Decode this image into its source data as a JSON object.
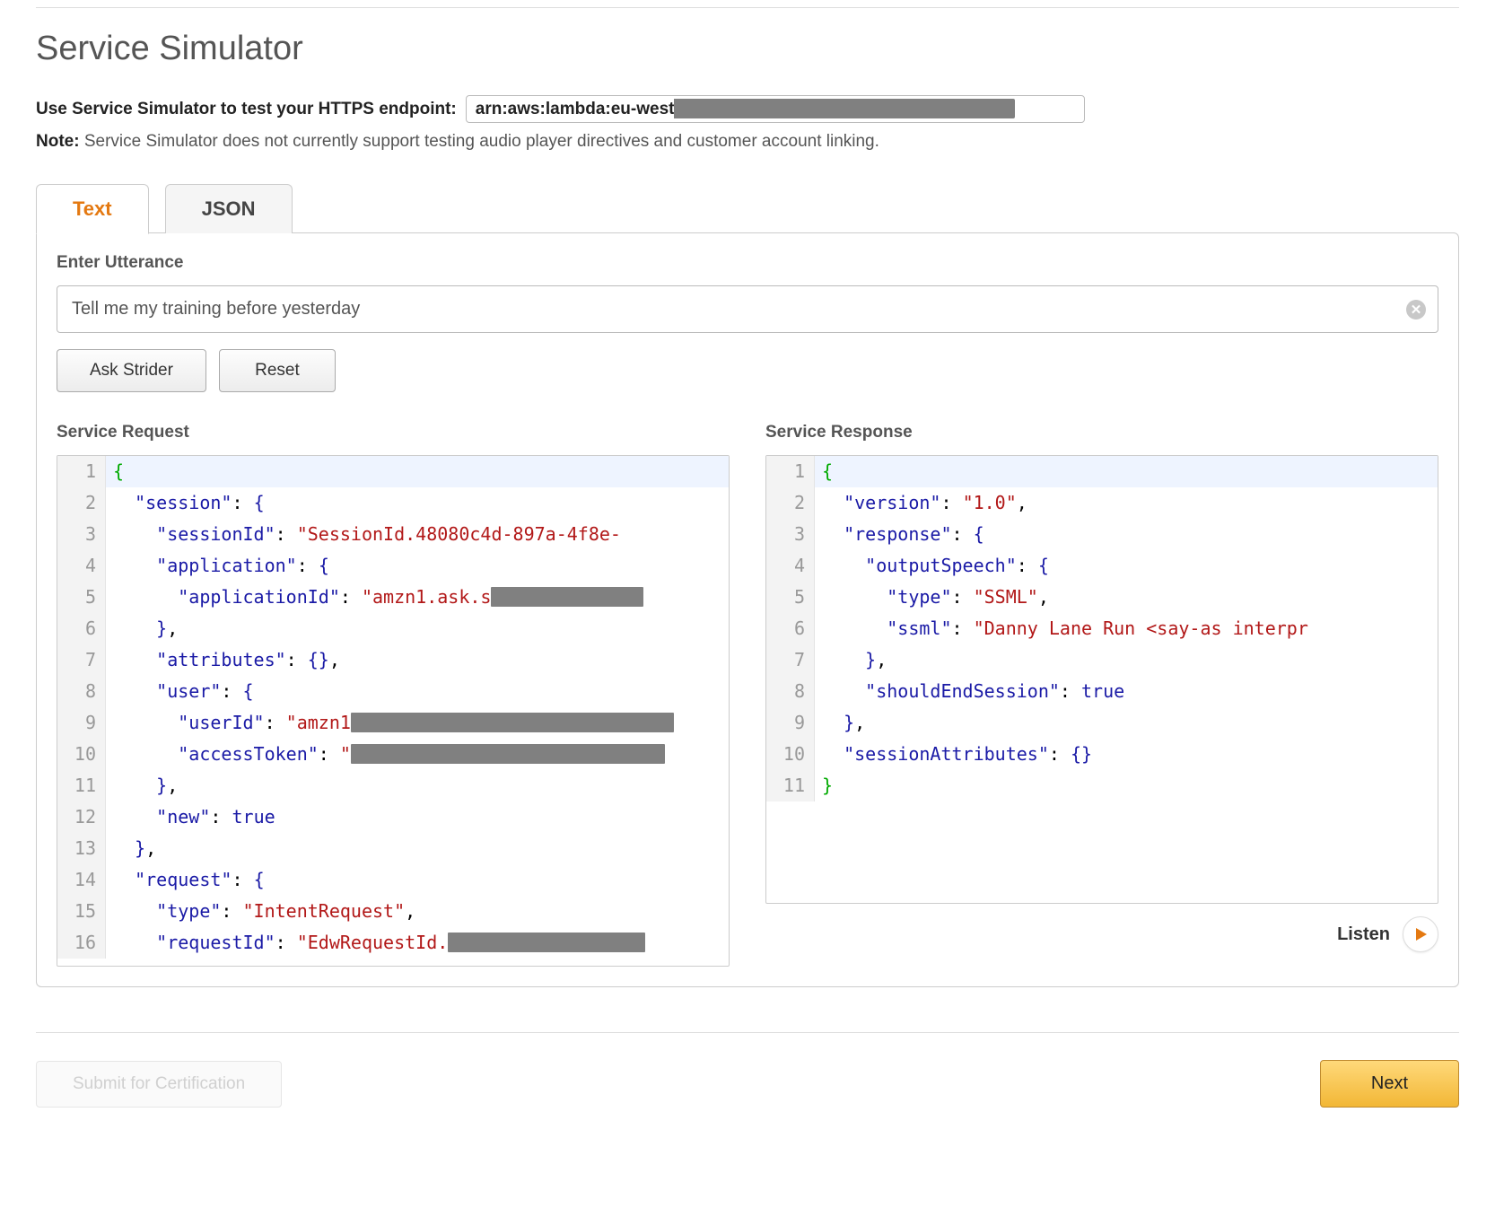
{
  "title": "Service Simulator",
  "intro_label": "Use Service Simulator to test your HTTPS endpoint:",
  "endpoint_prefix": "arn:aws:lambda:eu-west",
  "note_prefix": "Note:",
  "note_text": " Service Simulator does not currently support testing audio player directives and customer account linking.",
  "tabs": {
    "text": "Text",
    "json": "JSON"
  },
  "utterance": {
    "label": "Enter Utterance",
    "value": "Tell me my training before yesterday"
  },
  "buttons": {
    "ask": "Ask Strider",
    "reset": "Reset",
    "submit_cert": "Submit for Certification",
    "next": "Next",
    "listen": "Listen"
  },
  "request": {
    "label": "Service Request",
    "lines": [
      {
        "n": 1,
        "indent": 0,
        "tokens": [
          [
            "brace",
            "{"
          ]
        ]
      },
      {
        "n": 2,
        "indent": 1,
        "tokens": [
          [
            "key",
            "\"session\""
          ],
          [
            "punc",
            ": "
          ],
          [
            "brace-blue",
            "{"
          ]
        ]
      },
      {
        "n": 3,
        "indent": 2,
        "tokens": [
          [
            "key",
            "\"sessionId\""
          ],
          [
            "punc",
            ": "
          ],
          [
            "str",
            "\"SessionId.48080c4d-897a-4f8e-"
          ]
        ]
      },
      {
        "n": 4,
        "indent": 2,
        "tokens": [
          [
            "key",
            "\"application\""
          ],
          [
            "punc",
            ": "
          ],
          [
            "brace-blue",
            "{"
          ]
        ]
      },
      {
        "n": 5,
        "indent": 3,
        "tokens": [
          [
            "key",
            "\"applicationId\""
          ],
          [
            "punc",
            ": "
          ],
          [
            "str",
            "\"amzn1.ask.s"
          ],
          [
            "redact",
            170
          ]
        ]
      },
      {
        "n": 6,
        "indent": 2,
        "tokens": [
          [
            "brace-blue",
            "}"
          ],
          [
            "punc",
            ","
          ]
        ]
      },
      {
        "n": 7,
        "indent": 2,
        "tokens": [
          [
            "key",
            "\"attributes\""
          ],
          [
            "punc",
            ": "
          ],
          [
            "brace-blue",
            "{}"
          ],
          [
            "punc",
            ","
          ]
        ]
      },
      {
        "n": 8,
        "indent": 2,
        "tokens": [
          [
            "key",
            "\"user\""
          ],
          [
            "punc",
            ": "
          ],
          [
            "brace-blue",
            "{"
          ]
        ]
      },
      {
        "n": 9,
        "indent": 3,
        "tokens": [
          [
            "key",
            "\"userId\""
          ],
          [
            "punc",
            ": "
          ],
          [
            "str",
            "\"amzn1"
          ],
          [
            "redact",
            360
          ]
        ]
      },
      {
        "n": 10,
        "indent": 3,
        "tokens": [
          [
            "key",
            "\"accessToken\""
          ],
          [
            "punc",
            ": "
          ],
          [
            "str",
            "\""
          ],
          [
            "redact",
            350
          ]
        ]
      },
      {
        "n": 11,
        "indent": 2,
        "tokens": [
          [
            "brace-blue",
            "}"
          ],
          [
            "punc",
            ","
          ]
        ]
      },
      {
        "n": 12,
        "indent": 2,
        "tokens": [
          [
            "key",
            "\"new\""
          ],
          [
            "punc",
            ": "
          ],
          [
            "bool",
            "true"
          ]
        ]
      },
      {
        "n": 13,
        "indent": 1,
        "tokens": [
          [
            "brace-blue",
            "}"
          ],
          [
            "punc",
            ","
          ]
        ]
      },
      {
        "n": 14,
        "indent": 1,
        "tokens": [
          [
            "key",
            "\"request\""
          ],
          [
            "punc",
            ": "
          ],
          [
            "brace-blue",
            "{"
          ]
        ]
      },
      {
        "n": 15,
        "indent": 2,
        "tokens": [
          [
            "key",
            "\"type\""
          ],
          [
            "punc",
            ": "
          ],
          [
            "str",
            "\"IntentRequest\""
          ],
          [
            "punc",
            ","
          ]
        ]
      },
      {
        "n": 16,
        "indent": 2,
        "tokens": [
          [
            "key",
            "\"requestId\""
          ],
          [
            "punc",
            ": "
          ],
          [
            "str",
            "\"EdwRequestId."
          ],
          [
            "redact",
            220
          ]
        ]
      }
    ]
  },
  "response": {
    "label": "Service Response",
    "lines": [
      {
        "n": 1,
        "indent": 0,
        "tokens": [
          [
            "brace",
            "{"
          ]
        ]
      },
      {
        "n": 2,
        "indent": 1,
        "tokens": [
          [
            "key",
            "\"version\""
          ],
          [
            "punc",
            ": "
          ],
          [
            "str",
            "\"1.0\""
          ],
          [
            "punc",
            ","
          ]
        ]
      },
      {
        "n": 3,
        "indent": 1,
        "tokens": [
          [
            "key",
            "\"response\""
          ],
          [
            "punc",
            ": "
          ],
          [
            "brace-blue",
            "{"
          ]
        ]
      },
      {
        "n": 4,
        "indent": 2,
        "tokens": [
          [
            "key",
            "\"outputSpeech\""
          ],
          [
            "punc",
            ": "
          ],
          [
            "brace-blue",
            "{"
          ]
        ]
      },
      {
        "n": 5,
        "indent": 3,
        "tokens": [
          [
            "key",
            "\"type\""
          ],
          [
            "punc",
            ": "
          ],
          [
            "str",
            "\"SSML\""
          ],
          [
            "punc",
            ","
          ]
        ]
      },
      {
        "n": 6,
        "indent": 3,
        "tokens": [
          [
            "key",
            "\"ssml\""
          ],
          [
            "punc",
            ": "
          ],
          [
            "str",
            "\"Danny Lane Run <say-as interpr"
          ]
        ]
      },
      {
        "n": 7,
        "indent": 2,
        "tokens": [
          [
            "brace-blue",
            "}"
          ],
          [
            "punc",
            ","
          ]
        ]
      },
      {
        "n": 8,
        "indent": 2,
        "tokens": [
          [
            "key",
            "\"shouldEndSession\""
          ],
          [
            "punc",
            ": "
          ],
          [
            "bool",
            "true"
          ]
        ]
      },
      {
        "n": 9,
        "indent": 1,
        "tokens": [
          [
            "brace-blue",
            "}"
          ],
          [
            "punc",
            ","
          ]
        ]
      },
      {
        "n": 10,
        "indent": 1,
        "tokens": [
          [
            "key",
            "\"sessionAttributes\""
          ],
          [
            "punc",
            ": "
          ],
          [
            "brace-blue",
            "{}"
          ]
        ]
      },
      {
        "n": 11,
        "indent": 0,
        "tokens": [
          [
            "brace",
            "}"
          ]
        ]
      }
    ]
  }
}
